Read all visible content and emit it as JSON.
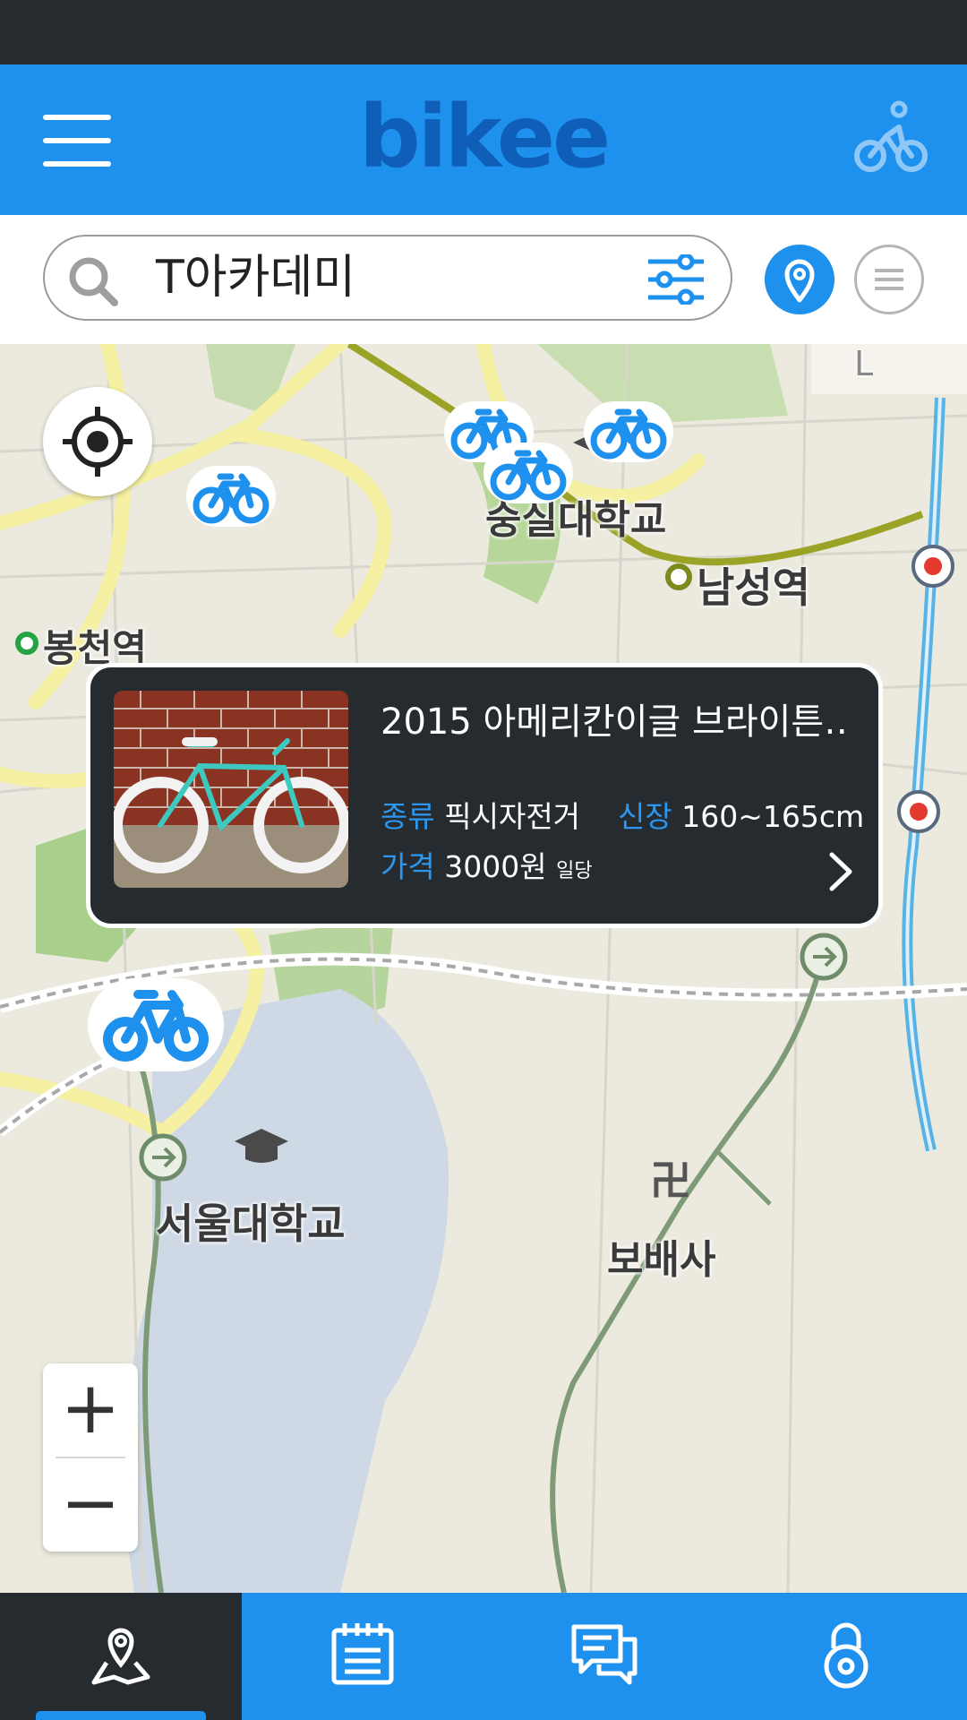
{
  "header": {
    "logo_text": "bikee",
    "menu_icon": "hamburger-menu-icon",
    "rider_icon": "cyclist-icon"
  },
  "search": {
    "query": "T아카데미",
    "search_icon": "search-icon",
    "filter_icon": "filter-sliders-icon",
    "map_mode_icon": "map-pin-icon",
    "list_mode_icon": "list-icon"
  },
  "map": {
    "labels": {
      "univ_top": "숭실대학교",
      "namseong": "남성역",
      "bongcheon": "봉천역",
      "snu": "서울대학교",
      "bobaesa": "보배사",
      "corner": "L"
    },
    "zoom_in": "+",
    "zoom_out": "−"
  },
  "popup": {
    "title": "2015 아메리칸이글 브라이튼‥",
    "type_key": "종류",
    "type_value": "픽시자전거",
    "height_key": "신장",
    "height_value": "160~165cm",
    "price_key": "가격",
    "price_value": "3000원",
    "price_unit": "일당"
  },
  "bottom_nav": {
    "tabs": [
      {
        "icon": "map-icon",
        "active": true
      },
      {
        "icon": "calendar-icon",
        "active": false
      },
      {
        "icon": "chat-icon",
        "active": false
      },
      {
        "icon": "lock-icon",
        "active": false
      }
    ]
  },
  "colors": {
    "brand_blue": "#1e91ee",
    "dark": "#262b30",
    "logo_blue": "#0f5fb8"
  }
}
